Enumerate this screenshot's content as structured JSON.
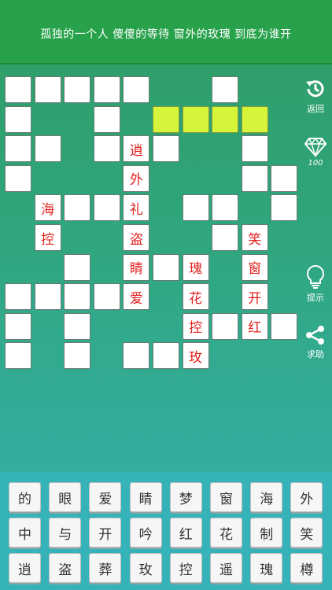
{
  "clue": "孤独的一个人 傻傻的等待 窗外的玫瑰 到底为谁开",
  "sidebar": {
    "back_label": "返回",
    "gems_count": "100",
    "hint_label": "提示",
    "help_label": "求助"
  },
  "grid": {
    "cells": [
      {
        "r": 0,
        "c": 0,
        "ch": ""
      },
      {
        "r": 0,
        "c": 1,
        "ch": ""
      },
      {
        "r": 0,
        "c": 2,
        "ch": ""
      },
      {
        "r": 0,
        "c": 3,
        "ch": ""
      },
      {
        "r": 0,
        "c": 4,
        "ch": ""
      },
      {
        "r": 0,
        "c": 7,
        "ch": ""
      },
      {
        "r": 1,
        "c": 0,
        "ch": ""
      },
      {
        "r": 1,
        "c": 3,
        "ch": ""
      },
      {
        "r": 1,
        "c": 5,
        "ch": "",
        "hl": true
      },
      {
        "r": 1,
        "c": 6,
        "ch": "",
        "hl": true
      },
      {
        "r": 1,
        "c": 7,
        "ch": "",
        "hl": true
      },
      {
        "r": 1,
        "c": 8,
        "ch": "",
        "hl": true
      },
      {
        "r": 2,
        "c": 0,
        "ch": ""
      },
      {
        "r": 2,
        "c": 1,
        "ch": ""
      },
      {
        "r": 2,
        "c": 3,
        "ch": ""
      },
      {
        "r": 2,
        "c": 4,
        "ch": "逍"
      },
      {
        "r": 2,
        "c": 5,
        "ch": ""
      },
      {
        "r": 2,
        "c": 8,
        "ch": ""
      },
      {
        "r": 3,
        "c": 0,
        "ch": ""
      },
      {
        "r": 3,
        "c": 4,
        "ch": "外"
      },
      {
        "r": 3,
        "c": 8,
        "ch": ""
      },
      {
        "r": 3,
        "c": 9,
        "ch": ""
      },
      {
        "r": 4,
        "c": 1,
        "ch": "海"
      },
      {
        "r": 4,
        "c": 2,
        "ch": ""
      },
      {
        "r": 4,
        "c": 3,
        "ch": ""
      },
      {
        "r": 4,
        "c": 4,
        "ch": "礼"
      },
      {
        "r": 4,
        "c": 6,
        "ch": ""
      },
      {
        "r": 4,
        "c": 7,
        "ch": ""
      },
      {
        "r": 4,
        "c": 9,
        "ch": ""
      },
      {
        "r": 5,
        "c": 1,
        "ch": "控"
      },
      {
        "r": 5,
        "c": 4,
        "ch": "盗"
      },
      {
        "r": 5,
        "c": 7,
        "ch": ""
      },
      {
        "r": 5,
        "c": 8,
        "ch": "笑"
      },
      {
        "r": 6,
        "c": 2,
        "ch": ""
      },
      {
        "r": 6,
        "c": 4,
        "ch": "睛"
      },
      {
        "r": 6,
        "c": 5,
        "ch": ""
      },
      {
        "r": 6,
        "c": 6,
        "ch": "瑰"
      },
      {
        "r": 6,
        "c": 8,
        "ch": "窗"
      },
      {
        "r": 7,
        "c": 0,
        "ch": ""
      },
      {
        "r": 7,
        "c": 1,
        "ch": ""
      },
      {
        "r": 7,
        "c": 2,
        "ch": ""
      },
      {
        "r": 7,
        "c": 3,
        "ch": ""
      },
      {
        "r": 7,
        "c": 4,
        "ch": "爱"
      },
      {
        "r": 7,
        "c": 6,
        "ch": "花"
      },
      {
        "r": 7,
        "c": 8,
        "ch": "开"
      },
      {
        "r": 8,
        "c": 0,
        "ch": ""
      },
      {
        "r": 8,
        "c": 2,
        "ch": ""
      },
      {
        "r": 8,
        "c": 6,
        "ch": "控"
      },
      {
        "r": 8,
        "c": 7,
        "ch": ""
      },
      {
        "r": 8,
        "c": 8,
        "ch": "红"
      },
      {
        "r": 8,
        "c": 9,
        "ch": ""
      },
      {
        "r": 9,
        "c": 0,
        "ch": ""
      },
      {
        "r": 9,
        "c": 2,
        "ch": ""
      },
      {
        "r": 9,
        "c": 4,
        "ch": ""
      },
      {
        "r": 9,
        "c": 5,
        "ch": ""
      },
      {
        "r": 9,
        "c": 6,
        "ch": "玫"
      }
    ]
  },
  "keyboard": {
    "rows": [
      [
        "的",
        "眼",
        "爱",
        "睛",
        "梦",
        "窗",
        "海",
        "外"
      ],
      [
        "中",
        "与",
        "开",
        "吟",
        "红",
        "花",
        "制",
        "笑"
      ],
      [
        "逍",
        "盗",
        "葬",
        "玫",
        "控",
        "遥",
        "瑰",
        "樽"
      ]
    ]
  },
  "colors": {
    "clue_bar": "#27a24a",
    "highlight": "#d6f53a",
    "filled_char": "#e0211f"
  }
}
